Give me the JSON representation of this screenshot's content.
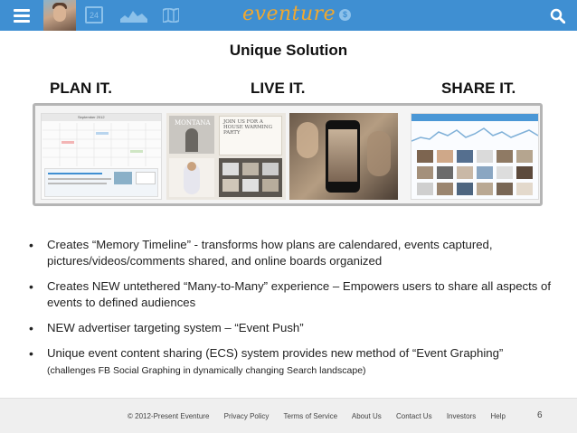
{
  "topbar": {
    "calendar_day": "24",
    "logo": "eventure",
    "coin_symbol": "$",
    "bg_color": "#3f8fd2",
    "logo_color": "#f0a830"
  },
  "slide": {
    "title": "Unique Solution",
    "columns": [
      "PLAN IT.",
      "LIVE IT.",
      "SHARE IT."
    ],
    "bullets": [
      {
        "text": "Creates “Memory Timeline” - transforms how plans are calendared, events captured, pictures/videos/comments shared, and online boards organized"
      },
      {
        "text": "Creates NEW untethered “Many-to-Many” experience – Empowers users to share all aspects of events to defined audiences"
      },
      {
        "text": "NEW advertiser targeting system – “Event Push”"
      },
      {
        "text": "Unique event content sharing (ECS) system provides new method of “Event Graphing”",
        "sub": "(challenges FB Social Graphing in dynamically changing Search landscape)"
      }
    ]
  },
  "screens": {
    "calendar_header": "September 2012",
    "invite_title": "JOIN US FOR A HOUSE WARMING PARTY",
    "poster_name": "MONTANA"
  },
  "footer": {
    "copyright": "© 2012-Present Eventure",
    "links": [
      "Privacy Policy",
      "Terms of Service",
      "About Us",
      "Contact Us",
      "Investors",
      "Help"
    ],
    "page_number": "6"
  }
}
